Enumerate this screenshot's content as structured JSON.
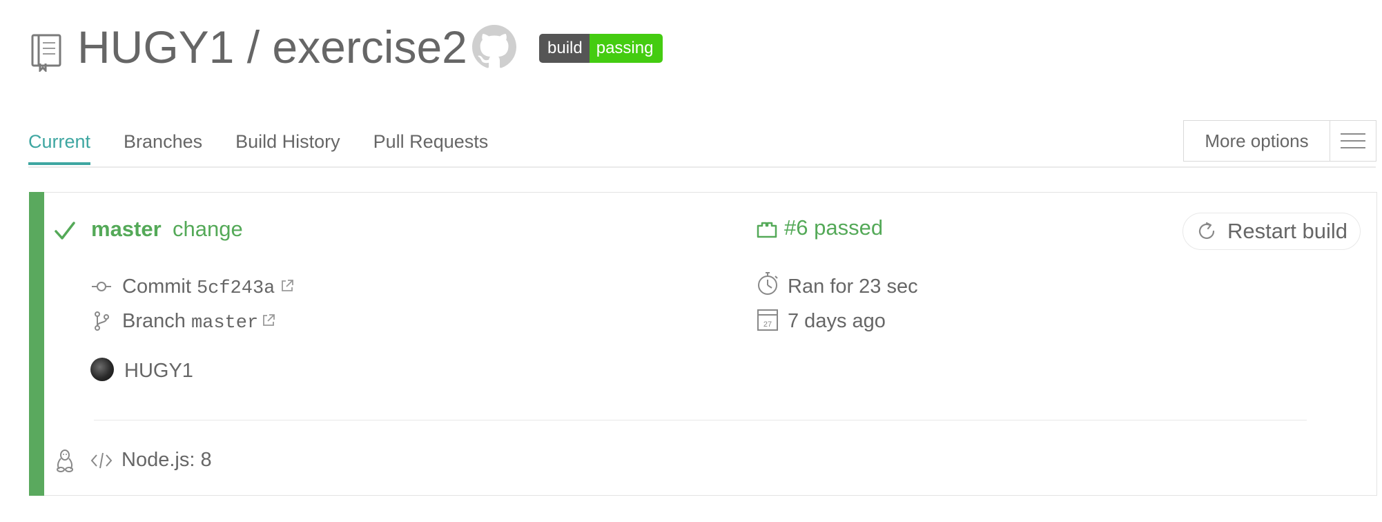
{
  "repo": {
    "owner": "HUGY1",
    "name": "exercise2",
    "title": "HUGY1 / exercise2"
  },
  "badge": {
    "left": "build",
    "right": "passing"
  },
  "tabs": [
    {
      "label": "Current",
      "active": true
    },
    {
      "label": "Branches",
      "active": false
    },
    {
      "label": "Build History",
      "active": false
    },
    {
      "label": "Pull Requests",
      "active": false
    }
  ],
  "more_options": {
    "label": "More options"
  },
  "build": {
    "branch": "master",
    "change_label": "change",
    "status_text": "#6 passed",
    "restart_label": "Restart build",
    "commit_label": "Commit",
    "commit_hash": "5cf243a",
    "branch_label": "Branch",
    "branch_value": "master",
    "duration": "Ran for 23 sec",
    "finished": "7 days ago",
    "calendar_day": "27",
    "author": "HUGY1",
    "language": "Node.js: 8"
  },
  "colors": {
    "success": "#54a958",
    "accent_tab": "#3ea6a1",
    "badge_green": "#44cc11",
    "badge_gray": "#555555"
  }
}
